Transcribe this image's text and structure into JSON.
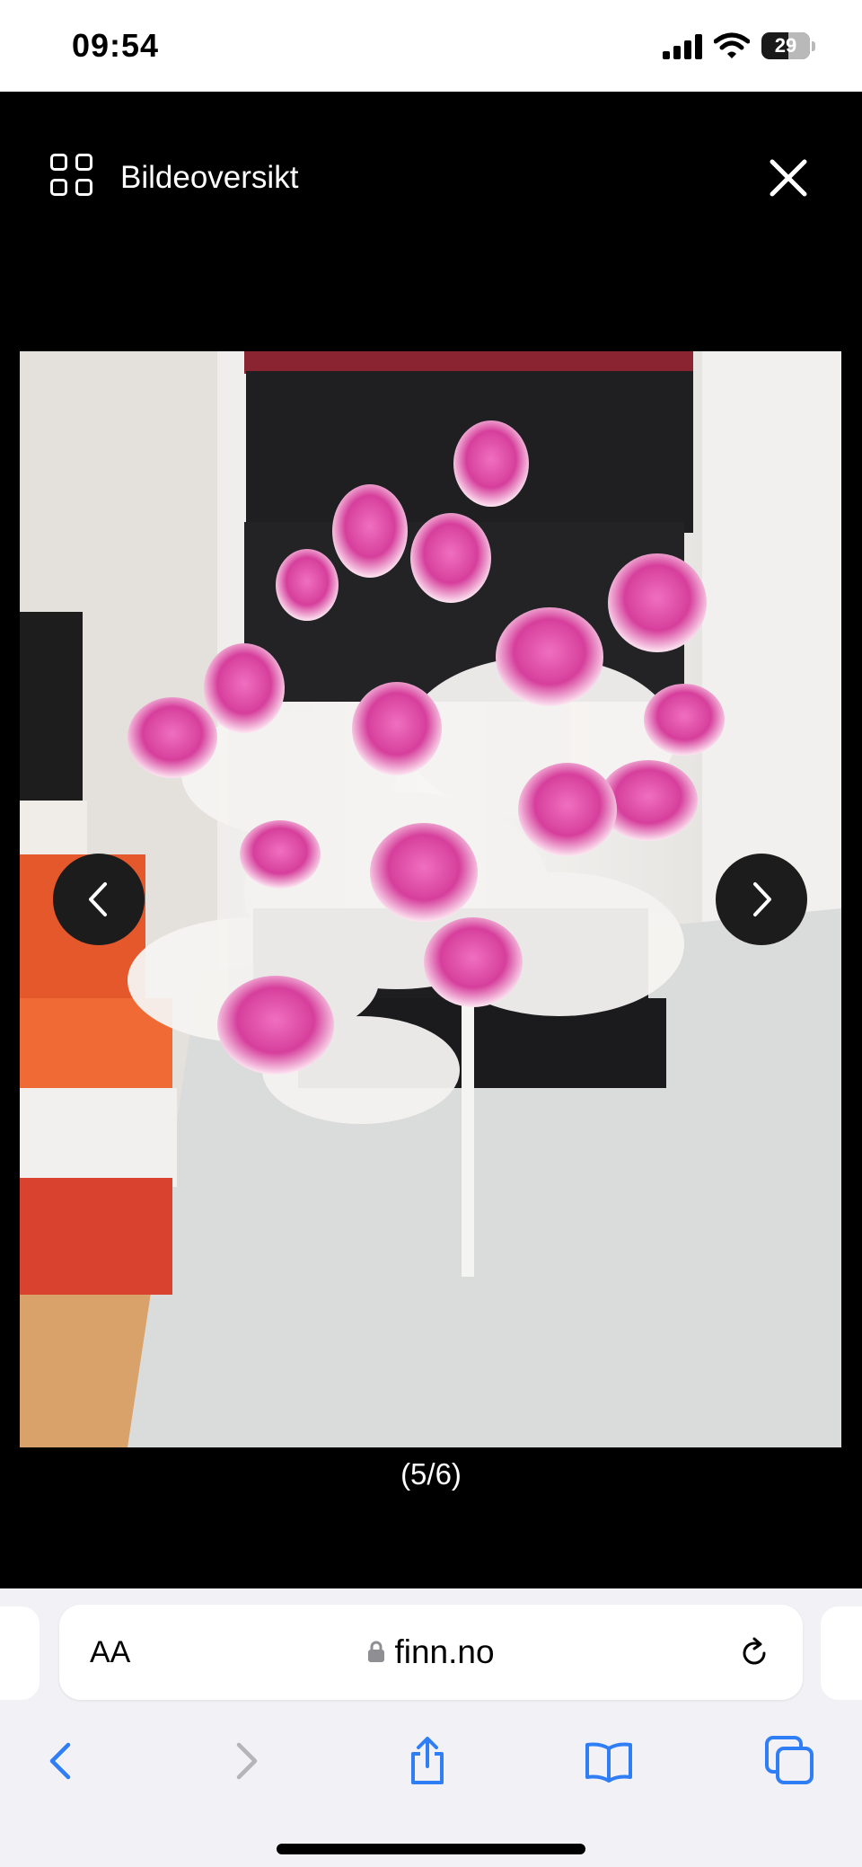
{
  "status_bar": {
    "time": "09:54",
    "battery_level": "29"
  },
  "viewer": {
    "overview_label": "Bildeoversikt",
    "counter": "(5/6)",
    "photo_alt": "Bukett med rosa og hvite kunstige roser"
  },
  "browser": {
    "text_size_label": "AA",
    "domain": "finn.no"
  },
  "colors": {
    "accent": "#2f7ef6",
    "viewer_bg": "#000000"
  },
  "icons": [
    "grid-icon",
    "close-icon",
    "chevron-left-icon",
    "chevron-right-icon",
    "lock-icon",
    "reload-icon",
    "back-icon",
    "forward-icon",
    "share-icon",
    "bookmarks-icon",
    "tabs-icon"
  ]
}
